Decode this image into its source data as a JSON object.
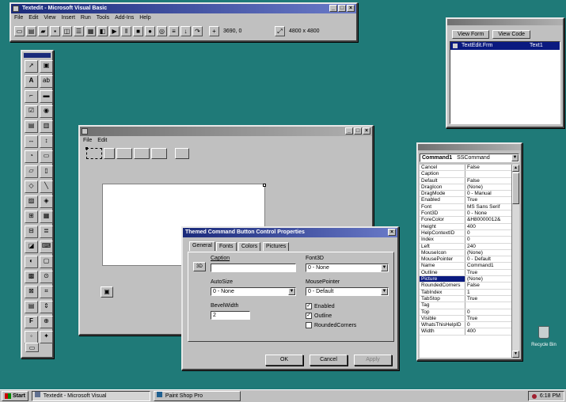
{
  "colors": {
    "desktop": "#1f7a78",
    "title_active": "#1a2a7a",
    "selection": "#0a1a80"
  },
  "vb_window": {
    "title": "Textedit - Microsoft Visual Basic",
    "menu": [
      "File",
      "Edit",
      "View",
      "Insert",
      "Run",
      "Tools",
      "Add-Ins",
      "Help"
    ],
    "toolbar_readout": "3690, 0",
    "toolbar_readout2": "4800 x 4800"
  },
  "project_window": {
    "buttons": [
      "View Form",
      "View Code"
    ],
    "item": "TextEdit.Frm",
    "item_right": "Text1"
  },
  "form_window": {
    "menu": [
      "File",
      "Edit"
    ]
  },
  "dialog": {
    "title": "Themed Command Button Control Properties",
    "tabs": [
      "General",
      "Fonts",
      "Colors",
      "Pictures"
    ],
    "caption_label": "Caption",
    "caption_value": "",
    "font3d_label": "Font3D",
    "font3d_value": "0 - None",
    "autosize_label": "AutoSize",
    "autosize_value": "0 - None",
    "mousepointer_label": "MousePointer",
    "mousepointer_value": "0 - Default",
    "bevelwidth_label": "BevelWidth",
    "bevelwidth_value": "2",
    "enabled_label": "Enabled",
    "outline_label": "Outline",
    "rounded_label": "RoundedCorners",
    "ok": "OK",
    "cancel": "Cancel",
    "apply": "Apply"
  },
  "properties": {
    "object": "Command1",
    "object_type": "SSCommand",
    "rows": [
      {
        "name": "Cancel",
        "value": "False"
      },
      {
        "name": "Caption",
        "value": ""
      },
      {
        "name": "Default",
        "value": "False"
      },
      {
        "name": "DragIcon",
        "value": "(None)"
      },
      {
        "name": "DragMode",
        "value": "0 - Manual"
      },
      {
        "name": "Enabled",
        "value": "True"
      },
      {
        "name": "Font",
        "value": "MS Sans Serif"
      },
      {
        "name": "Font3D",
        "value": "0 - None"
      },
      {
        "name": "ForeColor",
        "value": "&H80000012&"
      },
      {
        "name": "Height",
        "value": "400"
      },
      {
        "name": "HelpContextID",
        "value": "0"
      },
      {
        "name": "Index",
        "value": "0"
      },
      {
        "name": "Left",
        "value": "240"
      },
      {
        "name": "MouseIcon",
        "value": "(None)"
      },
      {
        "name": "MousePointer",
        "value": "0 - Default"
      },
      {
        "name": "Name",
        "value": "Command1"
      },
      {
        "name": "Outline",
        "value": "True"
      },
      {
        "name": "Picture",
        "value": "(None)"
      },
      {
        "name": "RoundedCorners",
        "value": "False"
      },
      {
        "name": "TabIndex",
        "value": "1"
      },
      {
        "name": "TabStop",
        "value": "True"
      },
      {
        "name": "Tag",
        "value": ""
      },
      {
        "name": "Top",
        "value": "0"
      },
      {
        "name": "Visible",
        "value": "True"
      },
      {
        "name": "WhatsThisHelpID",
        "value": "0"
      },
      {
        "name": "Width",
        "value": "400"
      }
    ]
  },
  "desktop": {
    "recycle_label": "Recycle Bin"
  },
  "taskbar": {
    "start": "Start",
    "tasks": [
      "Textedit - Microsoft Visual",
      "Paint Shop Pro"
    ],
    "clock": "6:18 PM"
  }
}
